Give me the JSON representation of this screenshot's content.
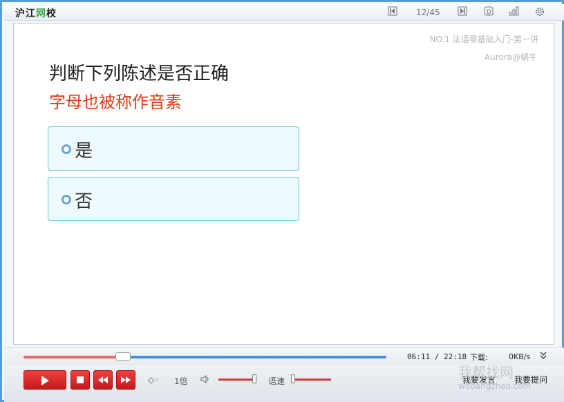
{
  "topbar": {
    "logo_part1": "沪江",
    "logo_part2": "网",
    "logo_part3": "校",
    "page_indicator": "12/45"
  },
  "slide": {
    "lesson_title": "NO.1 法语零基础入门-第一讲",
    "author": "Aurora@蜗牛",
    "question": "判断下列陈述是否正确",
    "statement": "字母也被称作音素",
    "options": [
      {
        "label": "是"
      },
      {
        "label": "否"
      }
    ]
  },
  "player": {
    "progress_fraction": 0.275,
    "time_current": "06:11",
    "time_total": "/ 22:18",
    "download_label": "下载:",
    "download_speed": "0KB/s",
    "speed_label": "1倍",
    "rate_label": "语速",
    "btn_comment": "我要发言",
    "btn_ask": "我要提问"
  },
  "watermark": {
    "text": "我帮找网",
    "url": "wobangzhao.com"
  },
  "colors": {
    "accent_blue": "#5b9bd5",
    "statement_red": "#e23a15",
    "option_border": "#58c9d6",
    "control_red": "#c41a1a"
  }
}
